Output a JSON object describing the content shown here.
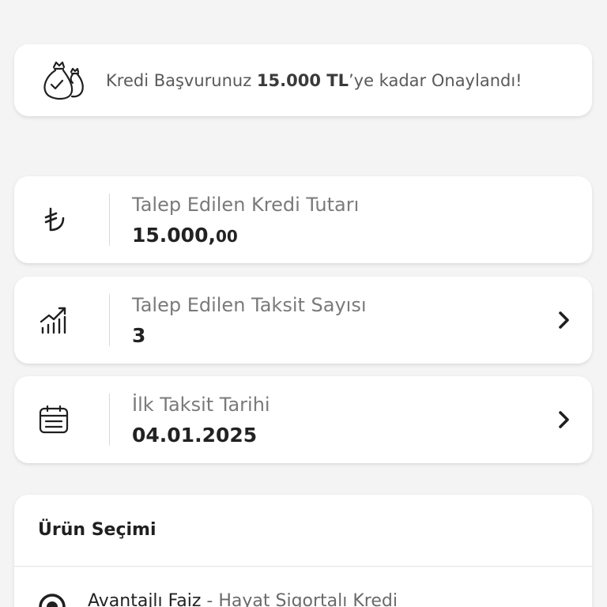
{
  "banner": {
    "prefix": "Kredi Başvurunuz ",
    "amount": "15.000 TL",
    "suffix": "’ye kadar Onaylandı!",
    "icon": "money-bags-check-icon"
  },
  "rows": [
    {
      "label": "Talep Edilen Kredi Tutarı",
      "value_main": "15.000,",
      "value_small": "00",
      "icon": "turkish-lira-icon"
    },
    {
      "label": "Talep Edilen Taksit Sayısı",
      "value": "3",
      "icon": "bar-chart-growth-icon"
    },
    {
      "label": "İlk Taksit Tarihi",
      "value": "04.01.2025",
      "icon": "calendar-icon"
    }
  ],
  "product": {
    "title": "Ürün Seçimi",
    "option_main": "Avantajlı Faiz",
    "option_sep": " - ",
    "option_sub": "Hayat Sigortalı Kredi"
  },
  "colors": {
    "background": "#f4f4f4",
    "card": "#ffffff",
    "label": "#7a7a7a",
    "value": "#222222"
  }
}
